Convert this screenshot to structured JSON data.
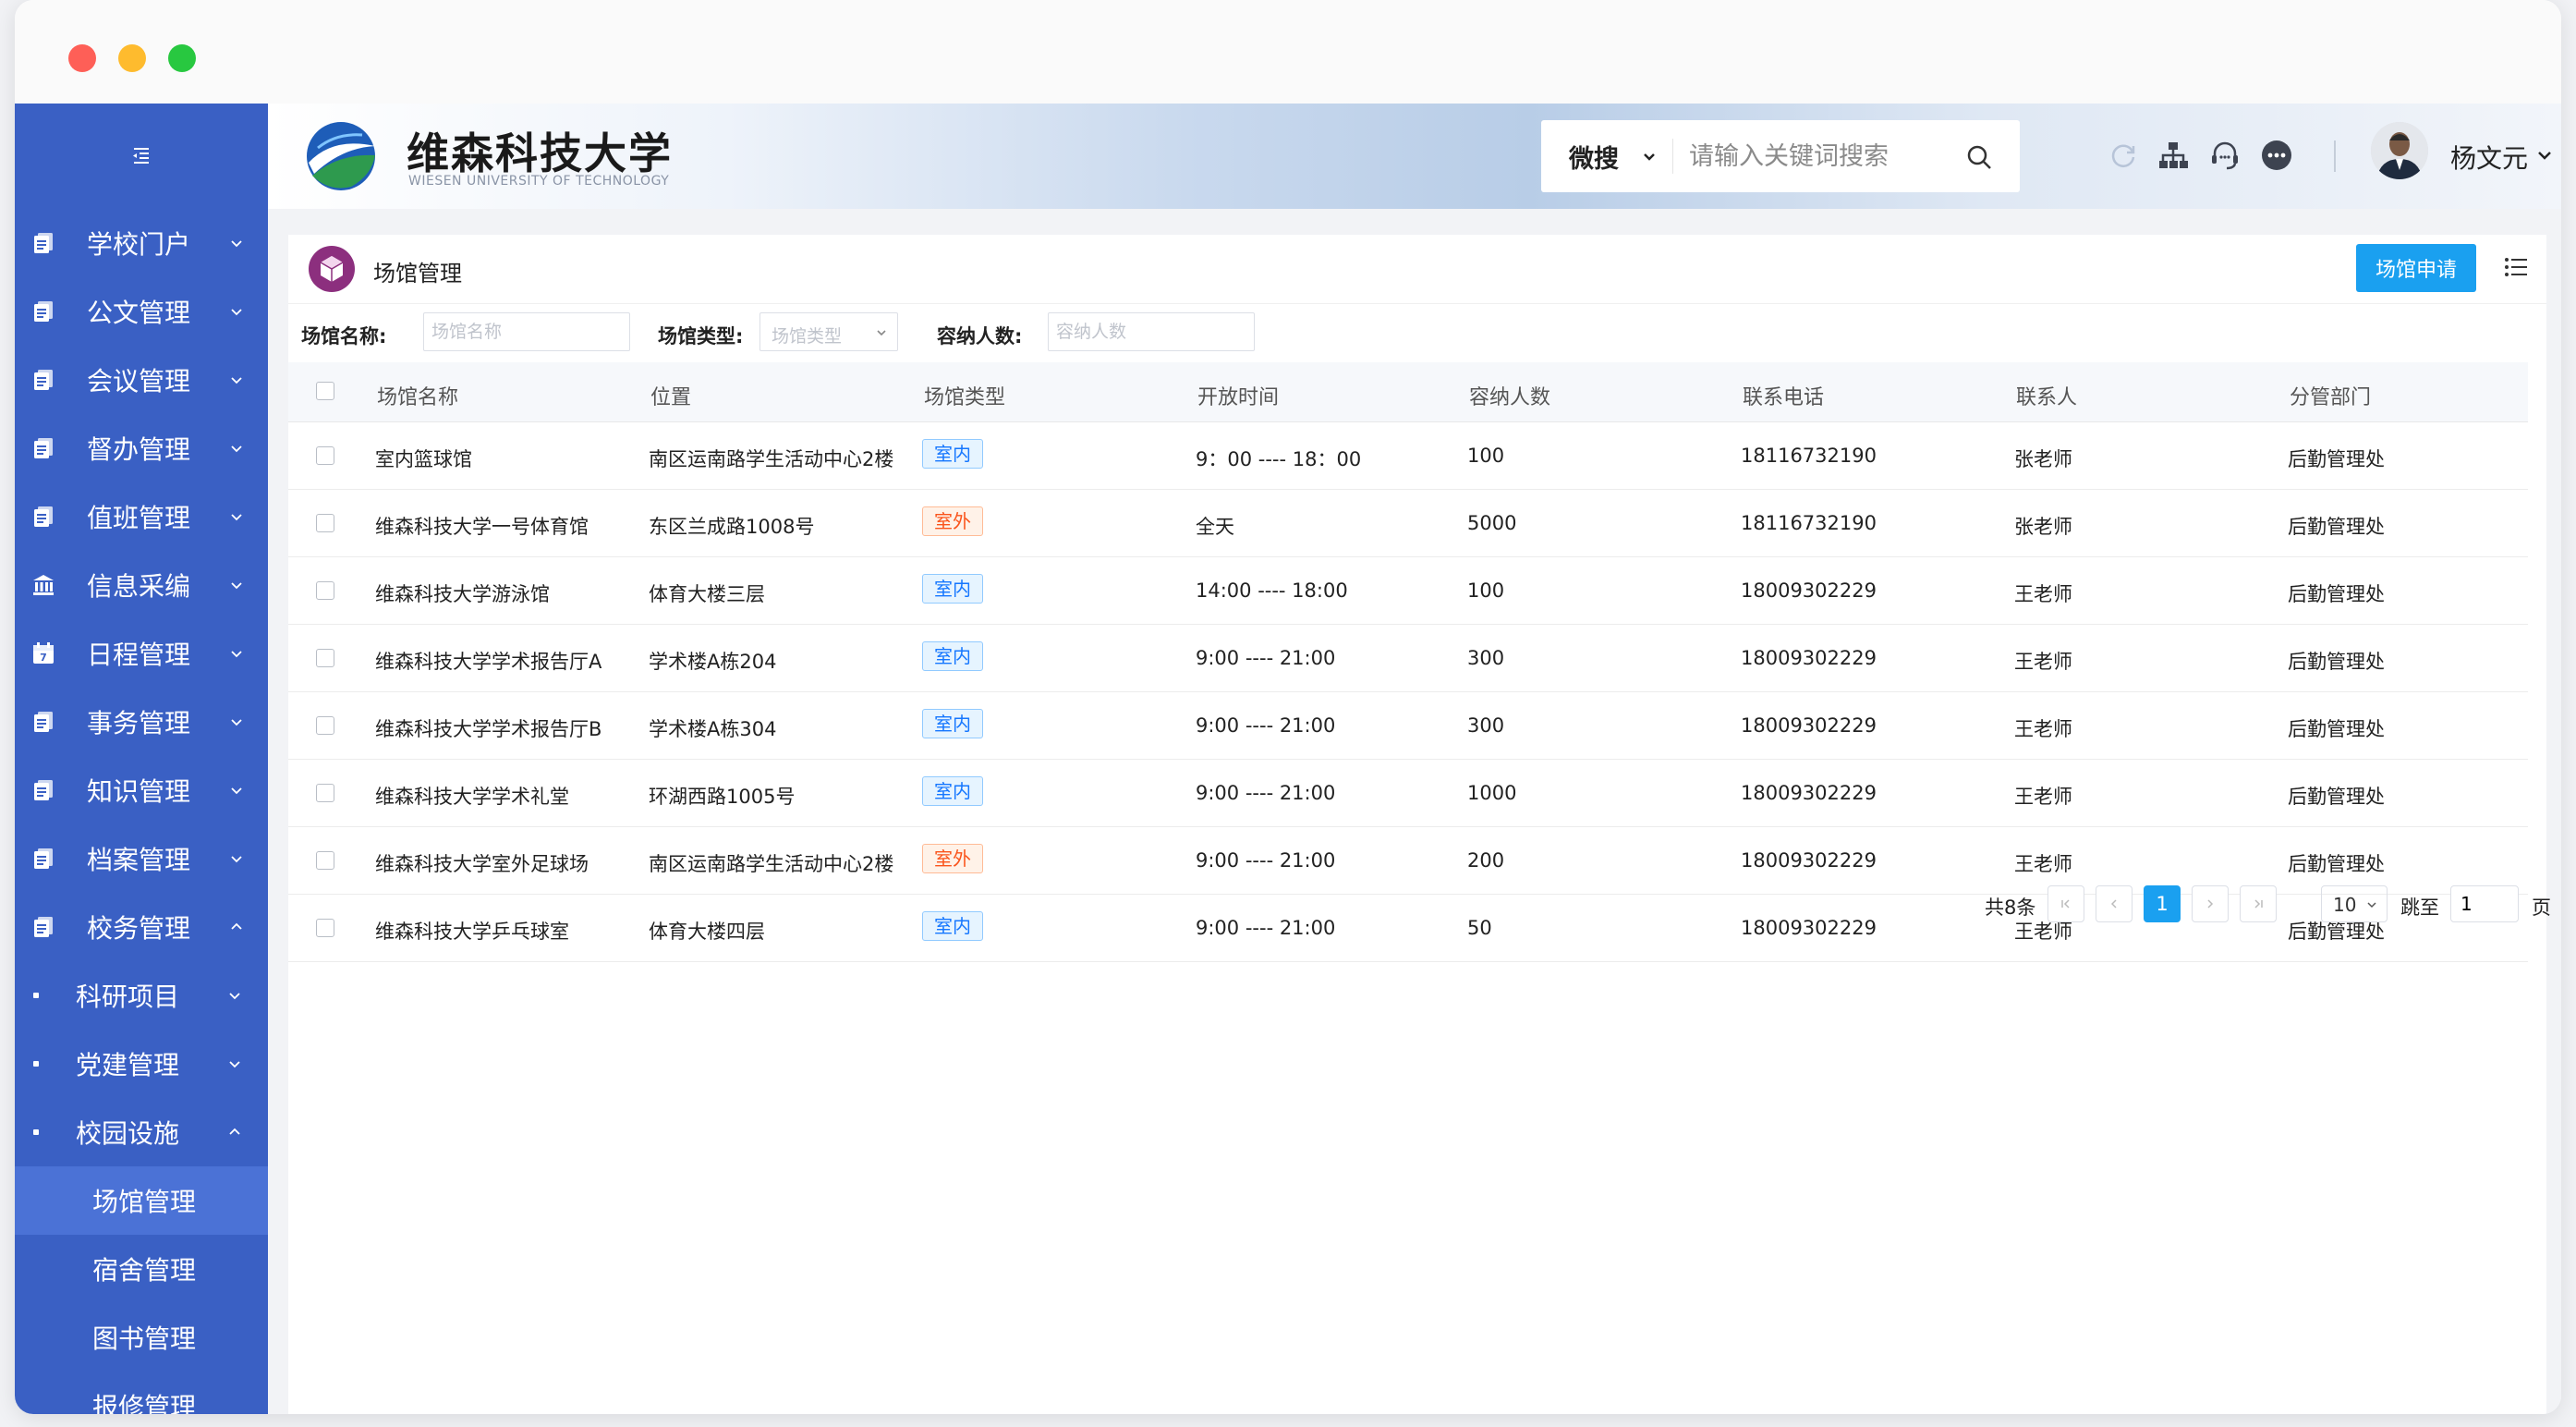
{
  "sidebar": {
    "menu": [
      {
        "label": "学校门户",
        "icon": "document-icon"
      },
      {
        "label": "公文管理",
        "icon": "document-icon"
      },
      {
        "label": "会议管理",
        "icon": "document-icon"
      },
      {
        "label": "督办管理",
        "icon": "document-icon"
      },
      {
        "label": "值班管理",
        "icon": "document-icon"
      },
      {
        "label": "信息采编",
        "icon": "bank-icon"
      },
      {
        "label": "日程管理",
        "icon": "calendar-icon"
      },
      {
        "label": "事务管理",
        "icon": "document-icon"
      },
      {
        "label": "知识管理",
        "icon": "document-icon"
      },
      {
        "label": "档案管理",
        "icon": "document-icon"
      },
      {
        "label": "校务管理",
        "icon": "document-icon"
      }
    ],
    "sub": [
      {
        "label": "科研项目"
      },
      {
        "label": "党建管理"
      },
      {
        "label": "校园设施"
      }
    ],
    "leaves": [
      {
        "label": "场馆管理"
      },
      {
        "label": "宿舍管理"
      },
      {
        "label": "图书管理"
      },
      {
        "label": "报修管理"
      }
    ]
  },
  "header": {
    "name": "维森科技大学",
    "english": "WIESEN UNIVERSITY OF TECHNOLOGY",
    "search_scope": "微搜",
    "search_placeholder": "请输入关键词搜索",
    "username": "杨文元"
  },
  "panel": {
    "title": "场馆管理",
    "apply": "场馆申请"
  },
  "filters": {
    "name_label": "场馆名称:",
    "name_placeholder": "场馆名称",
    "type_label": "场馆类型:",
    "type_placeholder": "场馆类型",
    "capacity_label": "容纳人数:",
    "capacity_placeholder": "容纳人数"
  },
  "table": {
    "columns": [
      "场馆名称",
      "位置",
      "场馆类型",
      "开放时间",
      "容纳人数",
      "联系电话",
      "联系人",
      "分管部门"
    ],
    "rows": [
      {
        "name": "室内篮球馆",
        "location": "南区运南路学生活动中心2楼",
        "type": "室内",
        "hours": "9：00 ---- 18：00",
        "capacity": "100",
        "phone": "18116732190",
        "contact": "张老师",
        "dept": "后勤管理处"
      },
      {
        "name": "维森科技大学一号体育馆",
        "location": "东区兰成路1008号",
        "type": "室外",
        "hours": "全天",
        "capacity": "5000",
        "phone": "18116732190",
        "contact": "张老师",
        "dept": "后勤管理处"
      },
      {
        "name": "维森科技大学游泳馆",
        "location": "体育大楼三层",
        "type": "室内",
        "hours": "14:00 ---- 18:00",
        "capacity": "100",
        "phone": "18009302229",
        "contact": "王老师",
        "dept": "后勤管理处"
      },
      {
        "name": "维森科技大学学术报告厅A",
        "location": "学术楼A栋204",
        "type": "室内",
        "hours": "9:00 ---- 21:00",
        "capacity": "300",
        "phone": "18009302229",
        "contact": "王老师",
        "dept": "后勤管理处"
      },
      {
        "name": "维森科技大学学术报告厅B",
        "location": "学术楼A栋304",
        "type": "室内",
        "hours": "9:00 ---- 21:00",
        "capacity": "300",
        "phone": "18009302229",
        "contact": "王老师",
        "dept": "后勤管理处"
      },
      {
        "name": "维森科技大学学术礼堂",
        "location": "环湖西路1005号",
        "type": "室内",
        "hours": "9:00 ---- 21:00",
        "capacity": "1000",
        "phone": "18009302229",
        "contact": "王老师",
        "dept": "后勤管理处"
      },
      {
        "name": "维森科技大学室外足球场",
        "location": "南区运南路学生活动中心2楼",
        "type": "室外",
        "hours": "9:00 ---- 21:00",
        "capacity": "200",
        "phone": "18009302229",
        "contact": "王老师",
        "dept": "后勤管理处"
      },
      {
        "name": "维森科技大学乒乓球室",
        "location": "体育大楼四层",
        "type": "室内",
        "hours": "9:00 ---- 21:00",
        "capacity": "50",
        "phone": "18009302229",
        "contact": "王老师",
        "dept": "后勤管理处"
      }
    ]
  },
  "pagination": {
    "total": "共8条",
    "current": "1",
    "page_size": "10",
    "goto_label": "跳至",
    "goto_value": "1",
    "goto_suffix": "页"
  },
  "colors": {
    "sidebar": "#3a60c4",
    "sidebar_active": "#4b72d6",
    "primary": "#1aa0f0",
    "indoor_tag": "#1677ff",
    "outdoor_tag": "#fa541c"
  }
}
